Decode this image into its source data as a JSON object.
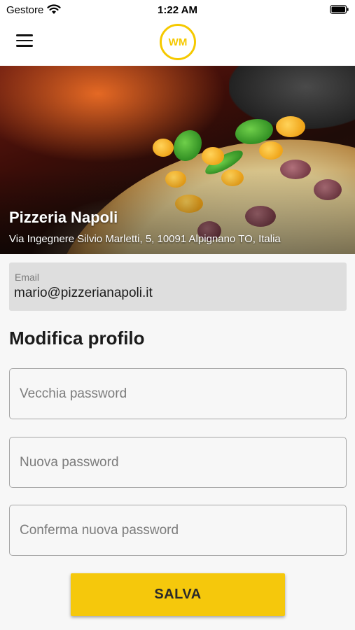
{
  "status_bar": {
    "carrier": "Gestore",
    "time": "1:22 AM",
    "wifi_icon": "wifi-icon",
    "battery_icon": "battery-icon"
  },
  "header": {
    "menu_icon": "hamburger-menu-icon",
    "logo_text": "WM",
    "brand_color": "#f5c900"
  },
  "restaurant": {
    "name": "Pizzeria Napoli",
    "address": "Via Ingegnere Silvio Marletti, 5, 10091 Alpignano TO, Italia"
  },
  "account": {
    "email_label": "Email",
    "email_value": "mario@pizzerianapoli.it"
  },
  "profile_form": {
    "title": "Modifica profilo",
    "old_password_placeholder": "Vecchia password",
    "new_password_placeholder": "Nuova password",
    "confirm_password_placeholder": "Conferma nuova password",
    "save_label": "SALVA",
    "button_color": "#f5c80c"
  }
}
